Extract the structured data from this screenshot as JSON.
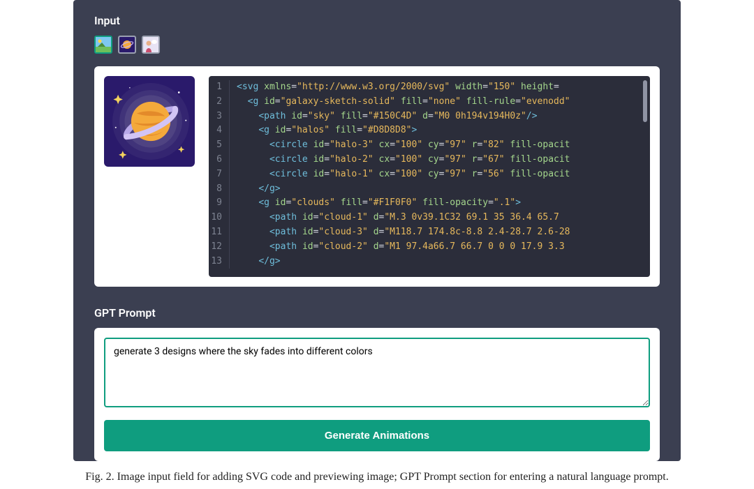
{
  "input": {
    "label": "Input",
    "thumbnails": [
      {
        "name": "landscape-thumb",
        "selected": true
      },
      {
        "name": "galaxy-thumb",
        "selected": false
      },
      {
        "name": "person-thumb",
        "selected": false
      }
    ]
  },
  "code": {
    "lines": [
      {
        "n": 1,
        "indent": 0,
        "segs": [
          {
            "t": "tag",
            "v": "<svg "
          },
          {
            "t": "attr",
            "v": "xmlns"
          },
          {
            "t": "plain",
            "v": "="
          },
          {
            "t": "str",
            "v": "\"http://www.w3.org/2000/svg\""
          },
          {
            "t": "plain",
            "v": " "
          },
          {
            "t": "attr",
            "v": "width"
          },
          {
            "t": "plain",
            "v": "="
          },
          {
            "t": "str",
            "v": "\"150\""
          },
          {
            "t": "plain",
            "v": " "
          },
          {
            "t": "attr",
            "v": "height"
          },
          {
            "t": "plain",
            "v": "="
          }
        ]
      },
      {
        "n": 2,
        "indent": 1,
        "segs": [
          {
            "t": "tag",
            "v": "<g "
          },
          {
            "t": "attr",
            "v": "id"
          },
          {
            "t": "plain",
            "v": "="
          },
          {
            "t": "str",
            "v": "\"galaxy-sketch-solid\""
          },
          {
            "t": "plain",
            "v": " "
          },
          {
            "t": "attr",
            "v": "fill"
          },
          {
            "t": "plain",
            "v": "="
          },
          {
            "t": "str",
            "v": "\"none\""
          },
          {
            "t": "plain",
            "v": " "
          },
          {
            "t": "attr",
            "v": "fill-rule"
          },
          {
            "t": "plain",
            "v": "="
          },
          {
            "t": "str",
            "v": "\"evenodd\""
          }
        ]
      },
      {
        "n": 3,
        "indent": 2,
        "segs": [
          {
            "t": "tag",
            "v": "<path "
          },
          {
            "t": "attr",
            "v": "id"
          },
          {
            "t": "plain",
            "v": "="
          },
          {
            "t": "str",
            "v": "\"sky\""
          },
          {
            "t": "plain",
            "v": " "
          },
          {
            "t": "attr",
            "v": "fill"
          },
          {
            "t": "plain",
            "v": "="
          },
          {
            "t": "str",
            "v": "\"#150C4D\""
          },
          {
            "t": "plain",
            "v": " "
          },
          {
            "t": "attr",
            "v": "d"
          },
          {
            "t": "plain",
            "v": "="
          },
          {
            "t": "str",
            "v": "\"M0 0h194v194H0z\""
          },
          {
            "t": "tag",
            "v": "/>"
          }
        ]
      },
      {
        "n": 4,
        "indent": 2,
        "segs": [
          {
            "t": "tag",
            "v": "<g "
          },
          {
            "t": "attr",
            "v": "id"
          },
          {
            "t": "plain",
            "v": "="
          },
          {
            "t": "str",
            "v": "\"halos\""
          },
          {
            "t": "plain",
            "v": " "
          },
          {
            "t": "attr",
            "v": "fill"
          },
          {
            "t": "plain",
            "v": "="
          },
          {
            "t": "str",
            "v": "\"#D8D8D8\""
          },
          {
            "t": "tag",
            "v": ">"
          }
        ]
      },
      {
        "n": 5,
        "indent": 3,
        "segs": [
          {
            "t": "tag",
            "v": "<circle "
          },
          {
            "t": "attr",
            "v": "id"
          },
          {
            "t": "plain",
            "v": "="
          },
          {
            "t": "str",
            "v": "\"halo-3\""
          },
          {
            "t": "plain",
            "v": " "
          },
          {
            "t": "attr",
            "v": "cx"
          },
          {
            "t": "plain",
            "v": "="
          },
          {
            "t": "str",
            "v": "\"100\""
          },
          {
            "t": "plain",
            "v": " "
          },
          {
            "t": "attr",
            "v": "cy"
          },
          {
            "t": "plain",
            "v": "="
          },
          {
            "t": "str",
            "v": "\"97\""
          },
          {
            "t": "plain",
            "v": " "
          },
          {
            "t": "attr",
            "v": "r"
          },
          {
            "t": "plain",
            "v": "="
          },
          {
            "t": "str",
            "v": "\"82\""
          },
          {
            "t": "plain",
            "v": " "
          },
          {
            "t": "attr",
            "v": "fill-opacit"
          }
        ]
      },
      {
        "n": 6,
        "indent": 3,
        "segs": [
          {
            "t": "tag",
            "v": "<circle "
          },
          {
            "t": "attr",
            "v": "id"
          },
          {
            "t": "plain",
            "v": "="
          },
          {
            "t": "str",
            "v": "\"halo-2\""
          },
          {
            "t": "plain",
            "v": " "
          },
          {
            "t": "attr",
            "v": "cx"
          },
          {
            "t": "plain",
            "v": "="
          },
          {
            "t": "str",
            "v": "\"100\""
          },
          {
            "t": "plain",
            "v": " "
          },
          {
            "t": "attr",
            "v": "cy"
          },
          {
            "t": "plain",
            "v": "="
          },
          {
            "t": "str",
            "v": "\"97\""
          },
          {
            "t": "plain",
            "v": " "
          },
          {
            "t": "attr",
            "v": "r"
          },
          {
            "t": "plain",
            "v": "="
          },
          {
            "t": "str",
            "v": "\"67\""
          },
          {
            "t": "plain",
            "v": " "
          },
          {
            "t": "attr",
            "v": "fill-opacit"
          }
        ]
      },
      {
        "n": 7,
        "indent": 3,
        "segs": [
          {
            "t": "tag",
            "v": "<circle "
          },
          {
            "t": "attr",
            "v": "id"
          },
          {
            "t": "plain",
            "v": "="
          },
          {
            "t": "str",
            "v": "\"halo-1\""
          },
          {
            "t": "plain",
            "v": " "
          },
          {
            "t": "attr",
            "v": "cx"
          },
          {
            "t": "plain",
            "v": "="
          },
          {
            "t": "str",
            "v": "\"100\""
          },
          {
            "t": "plain",
            "v": " "
          },
          {
            "t": "attr",
            "v": "cy"
          },
          {
            "t": "plain",
            "v": "="
          },
          {
            "t": "str",
            "v": "\"97\""
          },
          {
            "t": "plain",
            "v": " "
          },
          {
            "t": "attr",
            "v": "r"
          },
          {
            "t": "plain",
            "v": "="
          },
          {
            "t": "str",
            "v": "\"56\""
          },
          {
            "t": "plain",
            "v": " "
          },
          {
            "t": "attr",
            "v": "fill-opacit"
          }
        ]
      },
      {
        "n": 8,
        "indent": 2,
        "segs": [
          {
            "t": "tag",
            "v": "</g>"
          }
        ]
      },
      {
        "n": 9,
        "indent": 2,
        "segs": [
          {
            "t": "tag",
            "v": "<g "
          },
          {
            "t": "attr",
            "v": "id"
          },
          {
            "t": "plain",
            "v": "="
          },
          {
            "t": "str",
            "v": "\"clouds\""
          },
          {
            "t": "plain",
            "v": " "
          },
          {
            "t": "attr",
            "v": "fill"
          },
          {
            "t": "plain",
            "v": "="
          },
          {
            "t": "str",
            "v": "\"#F1F0F0\""
          },
          {
            "t": "plain",
            "v": " "
          },
          {
            "t": "attr",
            "v": "fill-opacity"
          },
          {
            "t": "plain",
            "v": "="
          },
          {
            "t": "str",
            "v": "\".1\""
          },
          {
            "t": "tag",
            "v": ">"
          }
        ]
      },
      {
        "n": 10,
        "indent": 3,
        "segs": [
          {
            "t": "tag",
            "v": "<path "
          },
          {
            "t": "attr",
            "v": "id"
          },
          {
            "t": "plain",
            "v": "="
          },
          {
            "t": "str",
            "v": "\"cloud-1\""
          },
          {
            "t": "plain",
            "v": " "
          },
          {
            "t": "attr",
            "v": "d"
          },
          {
            "t": "plain",
            "v": "="
          },
          {
            "t": "str",
            "v": "\"M.3 0v39.1C32 69.1 35 36.4 65.7 "
          }
        ]
      },
      {
        "n": 11,
        "indent": 3,
        "segs": [
          {
            "t": "tag",
            "v": "<path "
          },
          {
            "t": "attr",
            "v": "id"
          },
          {
            "t": "plain",
            "v": "="
          },
          {
            "t": "str",
            "v": "\"cloud-3\""
          },
          {
            "t": "plain",
            "v": " "
          },
          {
            "t": "attr",
            "v": "d"
          },
          {
            "t": "plain",
            "v": "="
          },
          {
            "t": "str",
            "v": "\"M118.7 174.8c-8.8 2.4-28.7 2.6-28"
          }
        ]
      },
      {
        "n": 12,
        "indent": 3,
        "segs": [
          {
            "t": "tag",
            "v": "<path "
          },
          {
            "t": "attr",
            "v": "id"
          },
          {
            "t": "plain",
            "v": "="
          },
          {
            "t": "str",
            "v": "\"cloud-2\""
          },
          {
            "t": "plain",
            "v": " "
          },
          {
            "t": "attr",
            "v": "d"
          },
          {
            "t": "plain",
            "v": "="
          },
          {
            "t": "str",
            "v": "\"M1 97.4a66.7 66.7 0 0 0 17.9 3.3"
          }
        ]
      },
      {
        "n": 13,
        "indent": 2,
        "segs": [
          {
            "t": "tag",
            "v": "</g>"
          }
        ]
      }
    ]
  },
  "prompt": {
    "label": "GPT Prompt",
    "value": "generate 3 designs where the sky fades into different colors",
    "button": "Generate Animations"
  },
  "caption": "Fig. 2.  Image input field for adding SVG code and previewing image; GPT Prompt section for entering a natural language prompt."
}
